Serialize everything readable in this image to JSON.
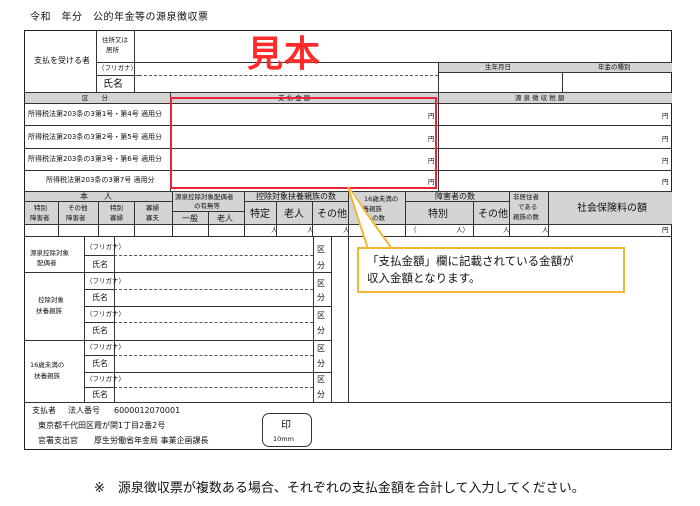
{
  "title": "令和　年分　公的年金等の源泉徴収票",
  "sample_stamp": "見本",
  "payee": {
    "label": "支払を受ける者",
    "address_label_line1": "住所又は",
    "address_label_line2": "居所",
    "furigana_label": "（フリガナ）",
    "name_label": "氏名",
    "birthdate_label": "生年月日",
    "pension_type_label": "年金の種別"
  },
  "columns": {
    "category": "区　　分",
    "payment_amount": "支 払 金 額",
    "withholding_tax": "源 泉 徴 収 税 額"
  },
  "rows": [
    {
      "label": "所得税法第203条の3第1号・第4号 適用分",
      "unit": "円",
      "tax_unit": "円"
    },
    {
      "label": "所得税法第203条の3第2号・第5号 適用分",
      "unit": "円",
      "tax_unit": "円"
    },
    {
      "label": "所得税法第203条の3第3号・第6号 適用分",
      "unit": "円",
      "tax_unit": "円"
    },
    {
      "label": "所得税法第203条の3第7号 適用分",
      "unit": "円",
      "tax_unit": "円"
    }
  ],
  "self": {
    "label": "本　　人",
    "special_disabled_line1": "特別",
    "special_disabled_line2": "障害者",
    "other_disabled_line1": "その他",
    "other_disabled_line2": "障害者",
    "special_widow_line1": "特別",
    "special_widow_line2": "寡婦",
    "widow_line1": "寡婦",
    "widow_line2": "寡夫"
  },
  "spouse": {
    "label_line1": "源泉控除対象配偶者",
    "label_line2": "の有無等",
    "general": "一般",
    "elderly": "老人"
  },
  "dependents": {
    "label": "控除対象扶養親族の数",
    "specific": "特定",
    "elderly": "老人",
    "other": "その他"
  },
  "under16": {
    "label_line1": "16歳未満の",
    "label_line2": "扶養親族",
    "label_line3": "の数"
  },
  "disabled_count": {
    "label": "障害者の数",
    "special": "特別",
    "other": "その他"
  },
  "nonresident": {
    "line1": "非居住者",
    "line2": "である",
    "line3": "親族の数"
  },
  "social_insurance": "社会保険料の額",
  "units": {
    "person": "人",
    "yen": "円",
    "paren_open": "（",
    "paren_close": "人）"
  },
  "family_sections": {
    "spouse_line1": "源泉控除対象",
    "spouse_line2": "配偶者",
    "dependent_line1": "控除対象",
    "dependent_line2": "扶養親族",
    "under16_line1": "16歳未満の",
    "under16_line2": "扶養親族",
    "furigana": "（フリガナ）",
    "name": "氏名",
    "kubun": "区",
    "bun": "分"
  },
  "payer": {
    "label": "支払者",
    "corp_number_label": "法人番号",
    "corp_number": "6000012070001",
    "address": "東京都千代田区霞が関1丁目2番2号",
    "office_prefix": "官署支出官",
    "office_name": "厚生労働省年金局 事業企画課長",
    "seal": "印",
    "seal_size": "10mm"
  },
  "callout_text_line1": "「支払金額」欄に記載されている金額が",
  "callout_text_line2": "収入金額となります。",
  "footer_note": "※　源泉徴収票が複数ある場合、それぞれの支払金額を合計して入力してください。",
  "colors": {
    "red_box": "#e8243a",
    "sample_stamp": "#ff2a2a",
    "callout_border": "#f2b534",
    "header_gray": "#d4d4d4"
  }
}
